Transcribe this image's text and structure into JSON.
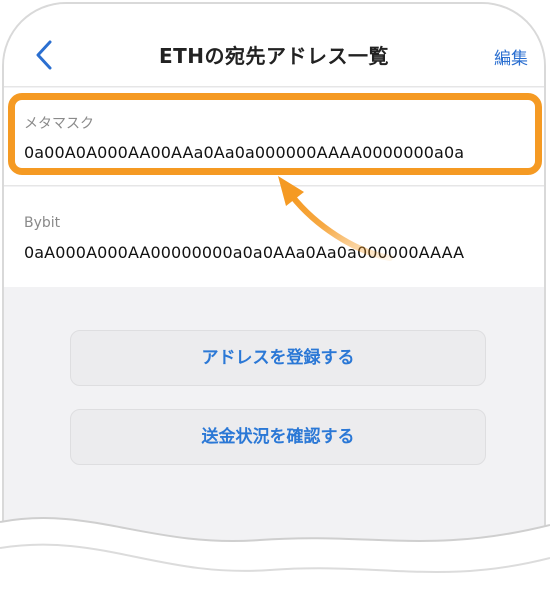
{
  "header": {
    "title": "ETHの宛先アドレス一覧",
    "edit_label": "編集"
  },
  "addresses": [
    {
      "label": "メタマスク",
      "address": "0a00A0A000AA00AAa0Aa0a000000AAAA0000000a0a"
    },
    {
      "label": "Bybit",
      "address": "0aA000A000AA00000000a0a0AAa0Aa0a000000AAAA"
    }
  ],
  "buttons": {
    "register_label": "アドレスを登録する",
    "status_label": "送金状況を確認する"
  },
  "colors": {
    "accent_blue": "#2b6fd0",
    "highlight_orange": "#f59a23",
    "background_gray": "#f2f2f4"
  },
  "icons": {
    "back": "chevron-left-icon",
    "pointer": "curved-arrow-icon"
  }
}
